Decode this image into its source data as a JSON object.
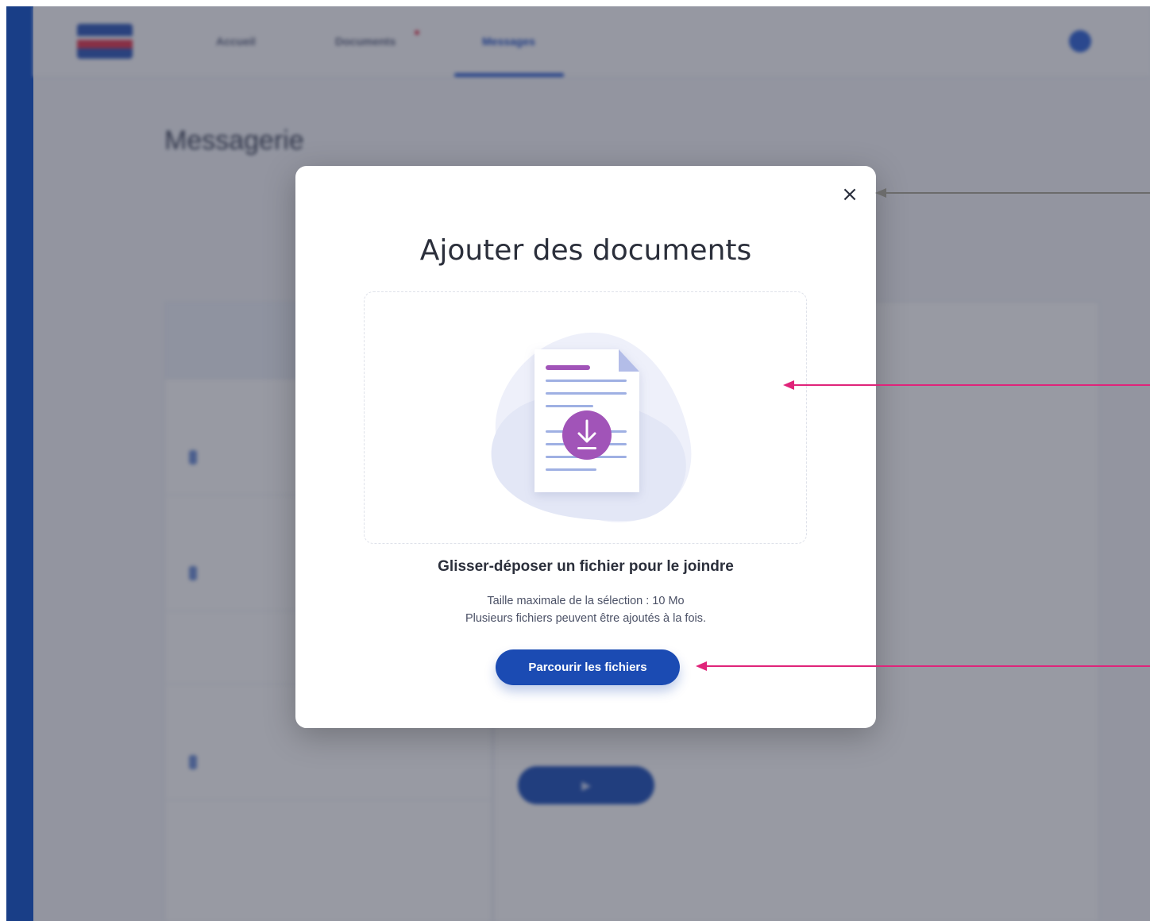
{
  "modal": {
    "title": "Ajouter des documents",
    "close_icon": "×",
    "dropzone": {
      "illustration_icon": "document-download-icon",
      "title": "Glisser-déposer un fichier pour le joindre",
      "max_size_text": "Taille maximale de la sélection : 10 Mo",
      "multiple_text": "Plusieurs fichiers peuvent être ajoutés à la fois."
    },
    "browse_label": "Parcourir les fichiers"
  },
  "background": {
    "nav": [
      "Accueil",
      "Documents",
      "Messages"
    ],
    "page_title": "Messagerie"
  },
  "colors": {
    "primary": "#1b4bb3",
    "accent_purple": "#a154b8",
    "annotation_pink": "#e0247a",
    "annotation_gray": "#6b6b6b"
  }
}
